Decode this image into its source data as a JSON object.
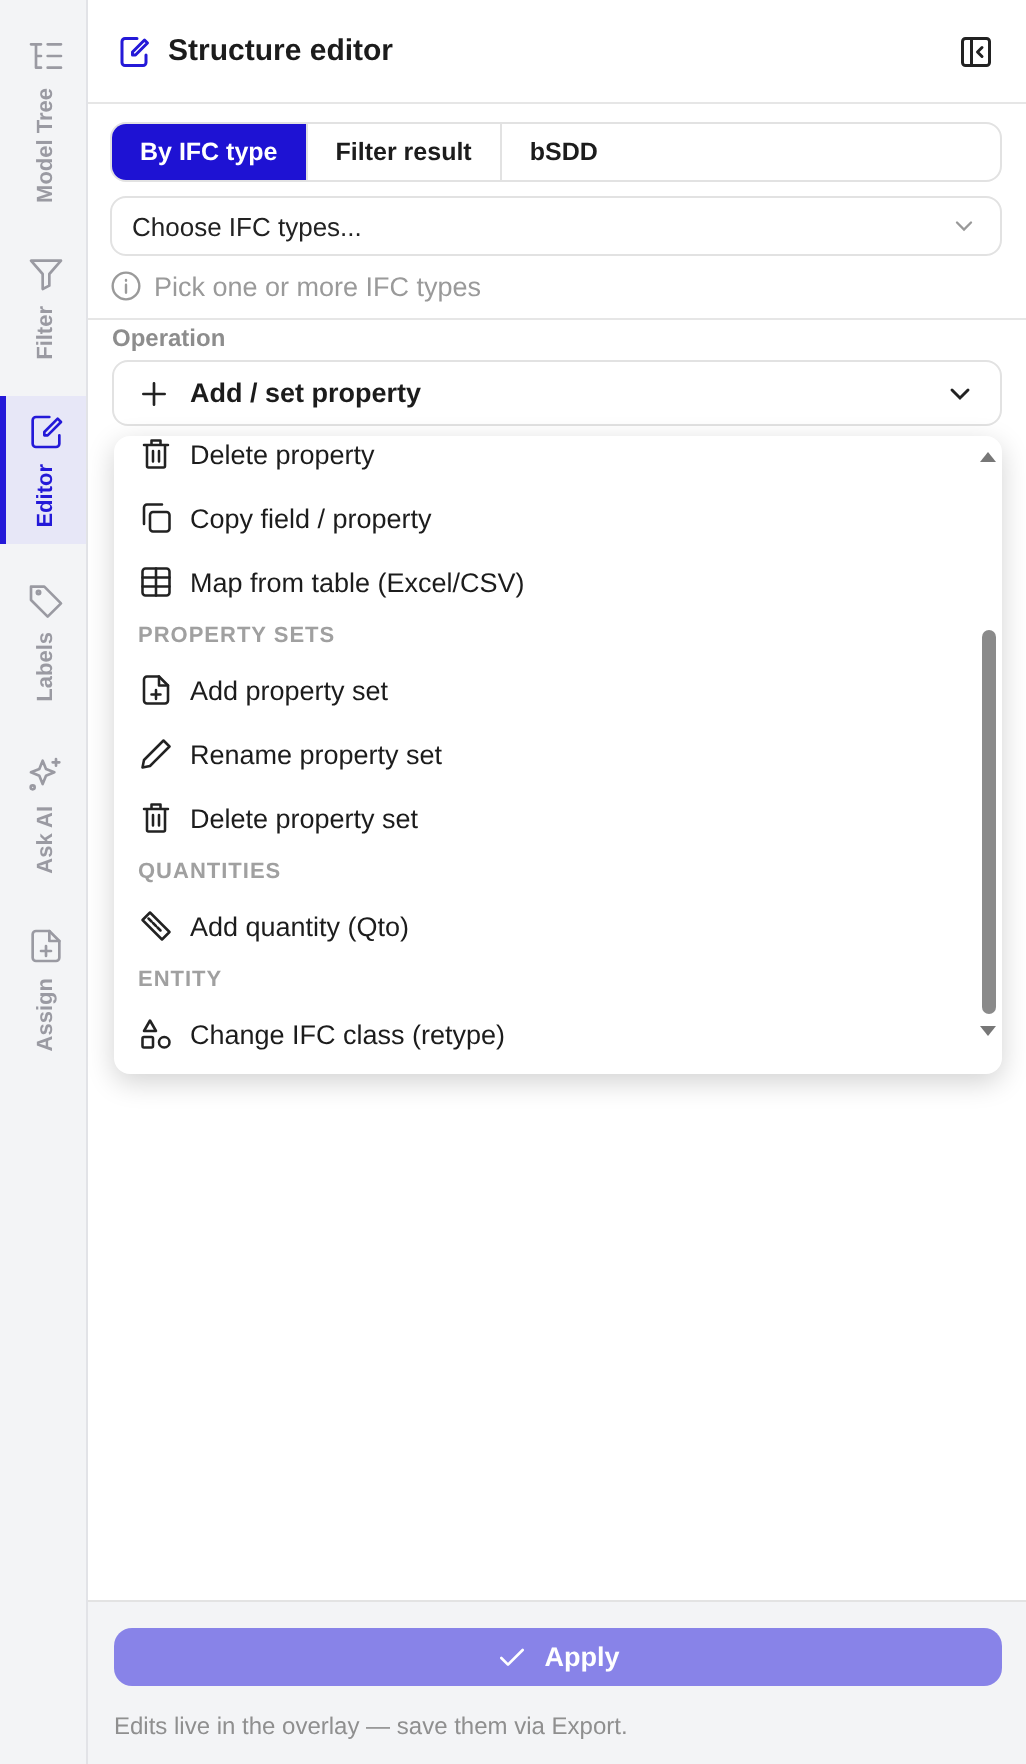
{
  "rail": [
    {
      "label": "Model Tree",
      "selected": false
    },
    {
      "label": "Filter",
      "selected": false
    },
    {
      "label": "Editor",
      "selected": true
    },
    {
      "label": "Labels",
      "selected": false
    },
    {
      "label": "Ask AI",
      "selected": false
    },
    {
      "label": "Assign",
      "selected": false
    }
  ],
  "panel": {
    "title": "Structure editor"
  },
  "tabs": [
    {
      "label": "By IFC type",
      "selected": true
    },
    {
      "label": "Filter result",
      "selected": false
    },
    {
      "label": "bSDD",
      "selected": false
    }
  ],
  "type_select": {
    "placeholder": "Choose IFC types..."
  },
  "hint": "Pick one or more IFC types",
  "operation": {
    "label": "Operation",
    "value": "Add / set property",
    "expanded": true
  },
  "menu": [
    {
      "kind": "item",
      "label": "Delete property"
    },
    {
      "kind": "item",
      "label": "Copy field / property"
    },
    {
      "kind": "item",
      "label": "Map from table (Excel/CSV)"
    },
    {
      "kind": "heading",
      "label": "PROPERTY SETS"
    },
    {
      "kind": "item",
      "label": "Add property set"
    },
    {
      "kind": "item",
      "label": "Rename property set"
    },
    {
      "kind": "item",
      "label": "Delete property set"
    },
    {
      "kind": "heading",
      "label": "QUANTITIES"
    },
    {
      "kind": "item",
      "label": "Add quantity (Qto)"
    },
    {
      "kind": "heading",
      "label": "ENTITY"
    },
    {
      "kind": "item",
      "label": "Change IFC class (retype)"
    }
  ],
  "apply": {
    "label": "Apply",
    "disabled": true
  },
  "footer_note": "Edits live in the overlay — save them via Export."
}
